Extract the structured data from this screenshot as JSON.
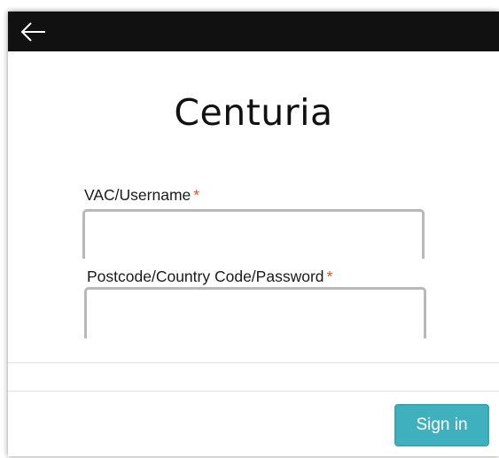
{
  "header": {
    "back_icon": "arrow-left-icon"
  },
  "brand": {
    "logo_text": "Centuria"
  },
  "form": {
    "username": {
      "label": "VAC/Username",
      "required_mark": "*",
      "value": ""
    },
    "password": {
      "label": "Postcode/Country Code/Password",
      "required_mark": "*",
      "value": ""
    }
  },
  "actions": {
    "signin_label": "Sign in"
  },
  "colors": {
    "topbar": "#111111",
    "required": "#d9532c",
    "signin_bg": "#3fb0be",
    "field_border": "#b8b8b8"
  }
}
